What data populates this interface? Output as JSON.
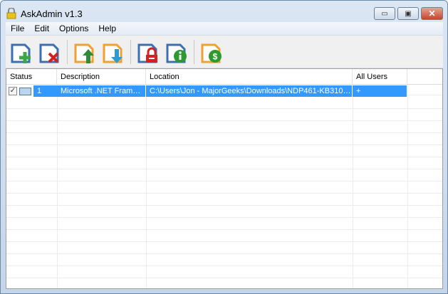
{
  "window": {
    "title": "AskAdmin v1.3",
    "icon": "lock-icon",
    "minimize": "minimize",
    "maximize": "maximize",
    "close": "close"
  },
  "menu": [
    "File",
    "Edit",
    "Options",
    "Help"
  ],
  "toolbar": [
    {
      "name": "add-file-button",
      "icon": "file-add-icon"
    },
    {
      "name": "remove-file-button",
      "icon": "file-remove-icon"
    },
    {
      "name": "import-button",
      "icon": "file-up-icon"
    },
    {
      "name": "export-button",
      "icon": "file-down-icon"
    },
    {
      "name": "lock-button",
      "icon": "file-lock-icon"
    },
    {
      "name": "info-button",
      "icon": "file-info-icon"
    },
    {
      "name": "donate-button",
      "icon": "file-dollar-icon"
    }
  ],
  "columns": [
    "Status",
    "Description",
    "Location",
    "All Users"
  ],
  "rows": [
    {
      "checked": true,
      "index": "1",
      "description": "Microsoft .NET Fram…",
      "location": "C:\\Users\\Jon - MajorGeeks\\Downloads\\NDP461-KB310…",
      "all_users": "+"
    }
  ],
  "colors": {
    "selection": "#3399ff"
  }
}
